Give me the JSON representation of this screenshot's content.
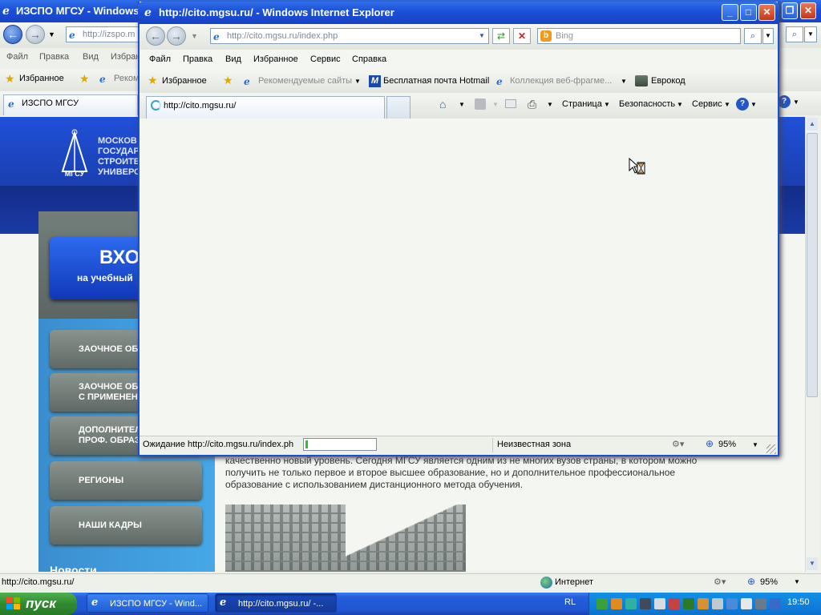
{
  "background_window": {
    "title": "ИЗСПО МГСУ - Windows",
    "address_partial": "http://izspo.m",
    "menu": [
      "Файл",
      "Правка",
      "Вид",
      "Избран"
    ],
    "favorites_label": "Избранное",
    "fav_partial": "Реком",
    "tab_label": "ИЗСПО МГСУ",
    "status_url": "http://cito.mgsu.ru/",
    "zone": "Интернет",
    "zoom": "95%"
  },
  "site": {
    "logo_text": "МГСУ",
    "header_lines": [
      "МОСКОВ",
      "ГОСУДАР",
      "СТРОИТЕ",
      "УНИВЕРС"
    ],
    "enter_title": "ВХО",
    "enter_subtitle": "на учебный",
    "nav": [
      {
        "label": "ЗАОЧНОЕ ОБУ"
      },
      {
        "label": "ЗАОЧНОЕ ОБУ\nС ПРИМЕНЕНИ"
      },
      {
        "label": "ДОПОЛНИТЕЛ\nПРОФ. ОБРАЗ"
      },
      {
        "label": "РЕГИОНЫ"
      },
      {
        "label": "НАШИ КАДРЫ"
      }
    ],
    "news_label": "Новости",
    "body_lines": [
      "качественно новый уровень. Сегодня МГСУ является одним из не многих вузов страны, в котором можно",
      "получить не только первое и второе высшее образование, но и дополнительное профессиональное",
      "образование с использованием дистанционного метода обучения."
    ]
  },
  "front_window": {
    "title": "http://cito.mgsu.ru/ - Windows Internet Explorer",
    "address": "http://cito.mgsu.ru/index.php",
    "address_host": "cito.mgsu.ru",
    "search_placeholder": "Bing",
    "menu": [
      "Файл",
      "Правка",
      "Вид",
      "Избранное",
      "Сервис",
      "Справка"
    ],
    "favorites": {
      "label": "Избранное",
      "items": [
        "Рекомендуемые сайты",
        "Бесплатная почта Hotmail",
        "Коллекция веб-фрагме...",
        "Еврокод"
      ]
    },
    "tab_label": "http://cito.mgsu.ru/",
    "commands": [
      "Страница",
      "Безопасность",
      "Сервис"
    ],
    "status_text": "Ожидание http://cito.mgsu.ru/index.ph",
    "progress": 0.04,
    "zone": "Неизвестная зона",
    "zoom": "95%"
  },
  "taskbar": {
    "start_label": "пуск",
    "items": [
      "ИЗСПО МГСУ - Wind...",
      "http://cito.mgsu.ru/ -..."
    ],
    "lang": "RL",
    "clock": "19:50"
  },
  "colors": {
    "xp_blue": "#1b4fd8",
    "site_blue": "#1a3fb0",
    "taskbar_green": "#2f8a2f"
  }
}
